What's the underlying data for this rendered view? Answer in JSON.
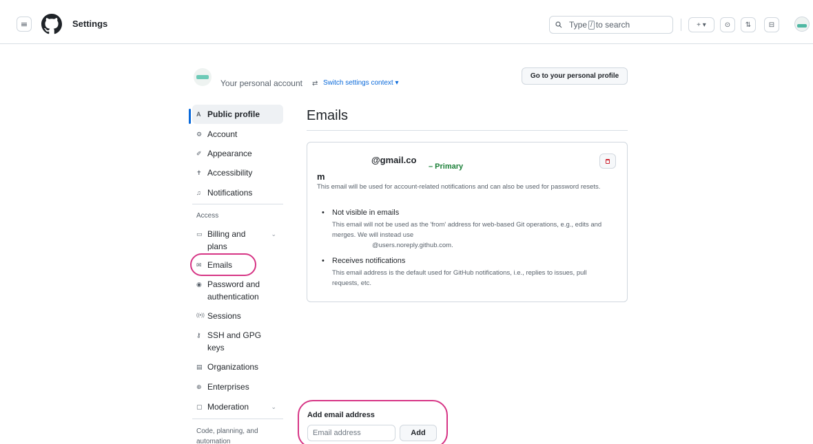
{
  "header": {
    "title": "Settings",
    "search": {
      "prefix": "Type",
      "key": "/",
      "suffix": "to search"
    },
    "buttons": {
      "plus": "+",
      "plus_chevron": "▾",
      "issues": "⊙",
      "pulls": "⇅",
      "inbox": "⊟"
    }
  },
  "context": {
    "account_text": "Your personal account",
    "switch_icon": "⇄",
    "switch_link": "Switch settings context ▾",
    "profile_button": "Go to your personal profile"
  },
  "sidebar": {
    "items": [
      {
        "icon": "person-icon",
        "glyph": "A",
        "label": "Public profile",
        "active": true
      },
      {
        "icon": "gear-icon",
        "glyph": "⚙",
        "label": "Account"
      },
      {
        "icon": "paintbrush-icon",
        "glyph": "✐",
        "label": "Appearance"
      },
      {
        "icon": "accessibility-icon",
        "glyph": "✝",
        "label": "Accessibility"
      },
      {
        "icon": "bell-icon",
        "glyph": "♫",
        "label": "Notifications"
      }
    ],
    "access_header": "Access",
    "access_items": [
      {
        "icon": "credit-card-icon",
        "glyph": "▭",
        "label_line1": "Billing and",
        "label_line2": "plans",
        "chevron": "⌄"
      },
      {
        "icon": "mail-icon",
        "glyph": "✉",
        "label": "Emails"
      },
      {
        "icon": "shield-lock-icon",
        "glyph": "◉",
        "label_line1": "Password and",
        "label_line2": "authentication"
      },
      {
        "icon": "broadcast-icon",
        "glyph": "((•))",
        "label": "Sessions"
      },
      {
        "icon": "key-icon",
        "glyph": "⚷",
        "label_line1": "SSH and GPG",
        "label_line2": "keys"
      },
      {
        "icon": "organization-icon",
        "glyph": "▤",
        "label": "Organizations"
      },
      {
        "icon": "globe-icon",
        "glyph": "⊕",
        "label": "Enterprises"
      },
      {
        "icon": "report-icon",
        "glyph": "▢",
        "label": "Moderation",
        "chevron": "⌄"
      }
    ],
    "code_header": "Code, planning, and automation"
  },
  "main": {
    "title": "Emails",
    "email": {
      "address_part1": "@gmail.co",
      "address_part2": "m",
      "primary_label": "– Primary",
      "description": "This email will be used for account-related notifications and can also be used for password resets.",
      "bullets": [
        {
          "title": "Not visible in emails",
          "desc1": "This email will not be used as the 'from' address for web-based Git operations, e.g., edits and merges. We will instead use",
          "desc2": "@users.noreply.github.com."
        },
        {
          "title": "Receives notifications",
          "desc1": "This email address is the default used for GitHub notifications, i.e., replies to issues, pull requests, etc."
        }
      ]
    },
    "add": {
      "title": "Add email address",
      "placeholder": "Email address",
      "button": "Add"
    }
  },
  "colors": {
    "accent": "#0969da",
    "success": "#1a7f37",
    "danger": "#cf222e",
    "highlight": "#d63384"
  }
}
